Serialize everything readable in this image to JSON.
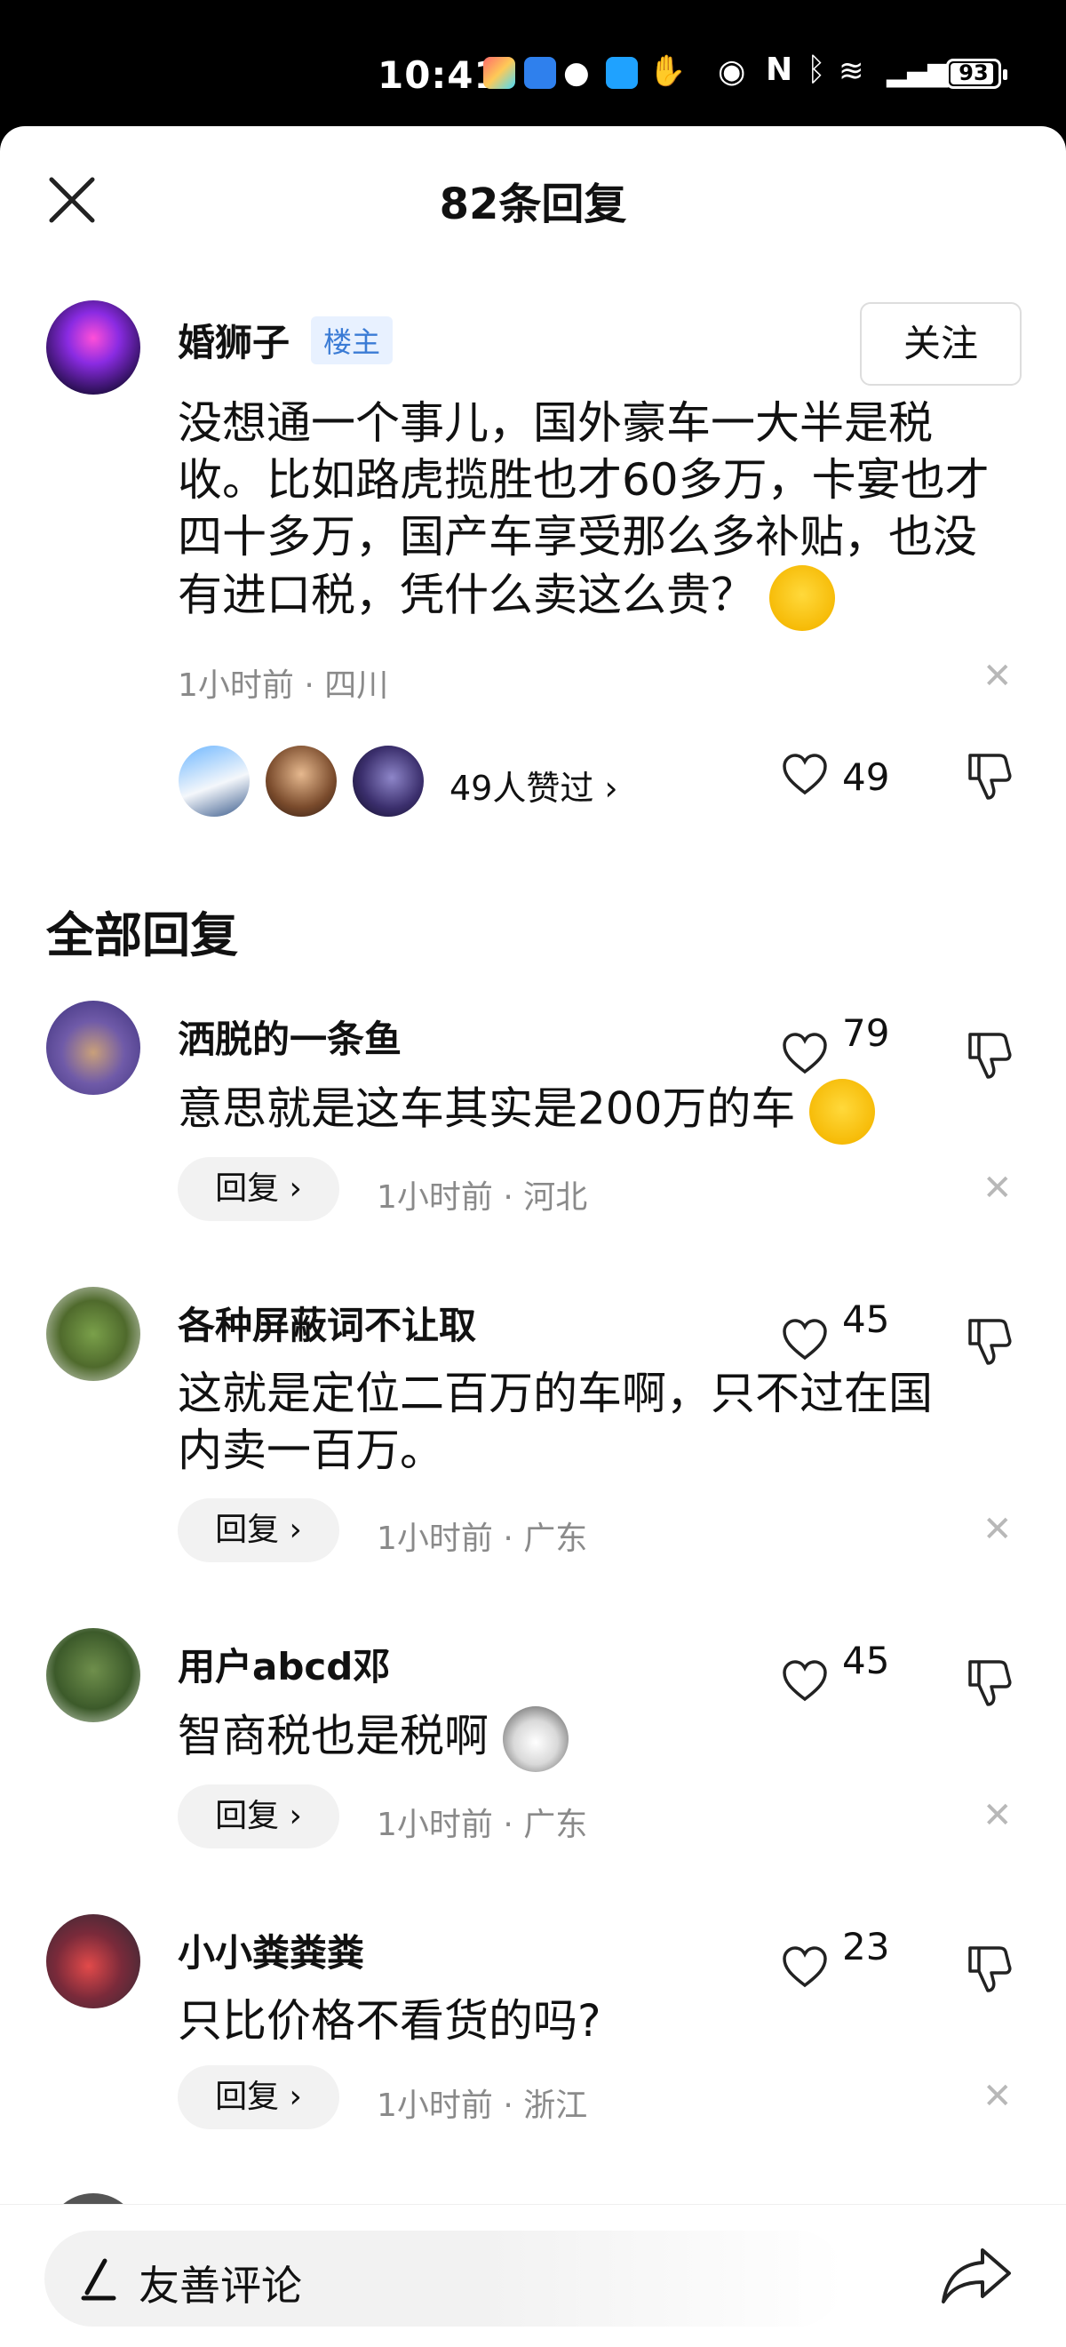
{
  "status_bar": {
    "time": "10:41",
    "battery": "93"
  },
  "header": {
    "title": "82条回复"
  },
  "original_post": {
    "username": "婚狮子",
    "badge": "楼主",
    "follow_label": "关注",
    "text": "没想通一个事儿，国外豪车一大半是税收。比如路虎揽胜也才60多万，卡宴也才四十多万，国产车享受那么多补贴，也没有进口税，凭什么卖这么贵？",
    "meta": "1小时前 · 四川",
    "likers_label": "49人赞过 ›",
    "likes": "49"
  },
  "section": {
    "title": "全部回复"
  },
  "replies": [
    {
      "username": "洒脱的一条鱼",
      "likes": "79",
      "text": "意思就是这车其实是200万的车",
      "reply_label": "回复 ›",
      "meta": "1小时前 · 河北"
    },
    {
      "username": "各种屏蔽词不让取",
      "likes": "45",
      "text_line1": "这就是定位二百万的车啊，只不过在国",
      "text_line2": "内卖一百万。",
      "reply_label": "回复 ›",
      "meta": "1小时前 · 广东"
    },
    {
      "username": "用户abcd邓",
      "likes": "45",
      "text": "智商税也是税啊",
      "reply_label": "回复 ›",
      "meta": "1小时前 · 广东"
    },
    {
      "username": "小小粪粪粪",
      "likes": "23",
      "text": "只比价格不看货的吗?",
      "reply_label": "回复 ›",
      "meta": "1小时前 · 浙江"
    }
  ],
  "bottom": {
    "placeholder": "友善评论"
  },
  "icons": {
    "close": "close-icon",
    "heart": "heart-icon",
    "dislike": "thumbs-down-icon",
    "dismiss": "x-icon",
    "share": "share-icon",
    "pen": "pen-icon"
  },
  "colors": {
    "badge_bg": "#e8f1ff",
    "badge_text": "#3a7bd5",
    "muted": "#8a8a8a"
  }
}
